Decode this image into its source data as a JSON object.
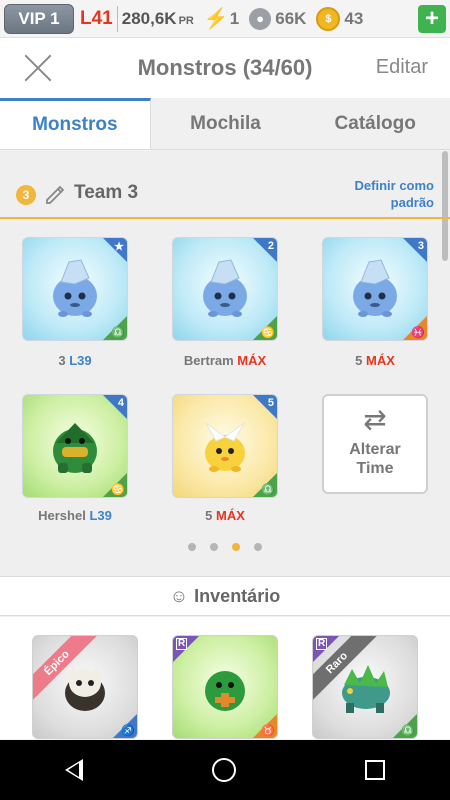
{
  "status_bar": {
    "vip": "VIP 1",
    "level": "L41",
    "power_value": "280,6K",
    "power_unit": "PR",
    "energy": "1",
    "food": "66K",
    "gold": "43",
    "add_label": "+"
  },
  "header": {
    "title": "Monstros (34/60)",
    "edit_label": "Editar"
  },
  "tabs": [
    "Monstros",
    "Mochila",
    "Catálogo"
  ],
  "team": {
    "number": "3",
    "name": "Team 3",
    "set_default": "Definir como padrão",
    "monsters": [
      {
        "name": "3",
        "level": "L39",
        "level_style": "blue",
        "badge": "★",
        "element": "♎",
        "element_color": "green",
        "kind": "blue"
      },
      {
        "name": "Bertram",
        "level": "MÁX",
        "level_style": "red",
        "badge": "2",
        "element": "♋",
        "element_color": "green",
        "kind": "blue"
      },
      {
        "name": "5",
        "level": "MÁX",
        "level_style": "red",
        "badge": "3",
        "element": "♓",
        "element_color": "orange",
        "kind": "blue"
      },
      {
        "name": "Hershel",
        "level": "L39",
        "level_style": "blue",
        "badge": "4",
        "element": "♋",
        "element_color": "green",
        "kind": "green"
      },
      {
        "name": "5",
        "level": "MÁX",
        "level_style": "red",
        "badge": "5",
        "element": "♎",
        "element_color": "green",
        "kind": "yellow"
      }
    ],
    "swap_label_line1": "Alterar",
    "swap_label_line2": "Time",
    "page_count": 4,
    "active_page": 3
  },
  "inventory": {
    "title": "Inventário",
    "items": [
      {
        "ribbon": "Épico",
        "ribbon_color": "pink",
        "rarity_tag": "",
        "element": "♐"
      },
      {
        "ribbon": "",
        "ribbon_color": "",
        "rarity_tag": "R",
        "element": "♉"
      },
      {
        "ribbon": "Raro",
        "ribbon_color": "dark",
        "rarity_tag": "R",
        "element": "♎"
      }
    ]
  },
  "colors": {
    "accent_blue": "#3d82c8",
    "accent_red": "#e8351f",
    "team_gold": "#f0b63e"
  }
}
